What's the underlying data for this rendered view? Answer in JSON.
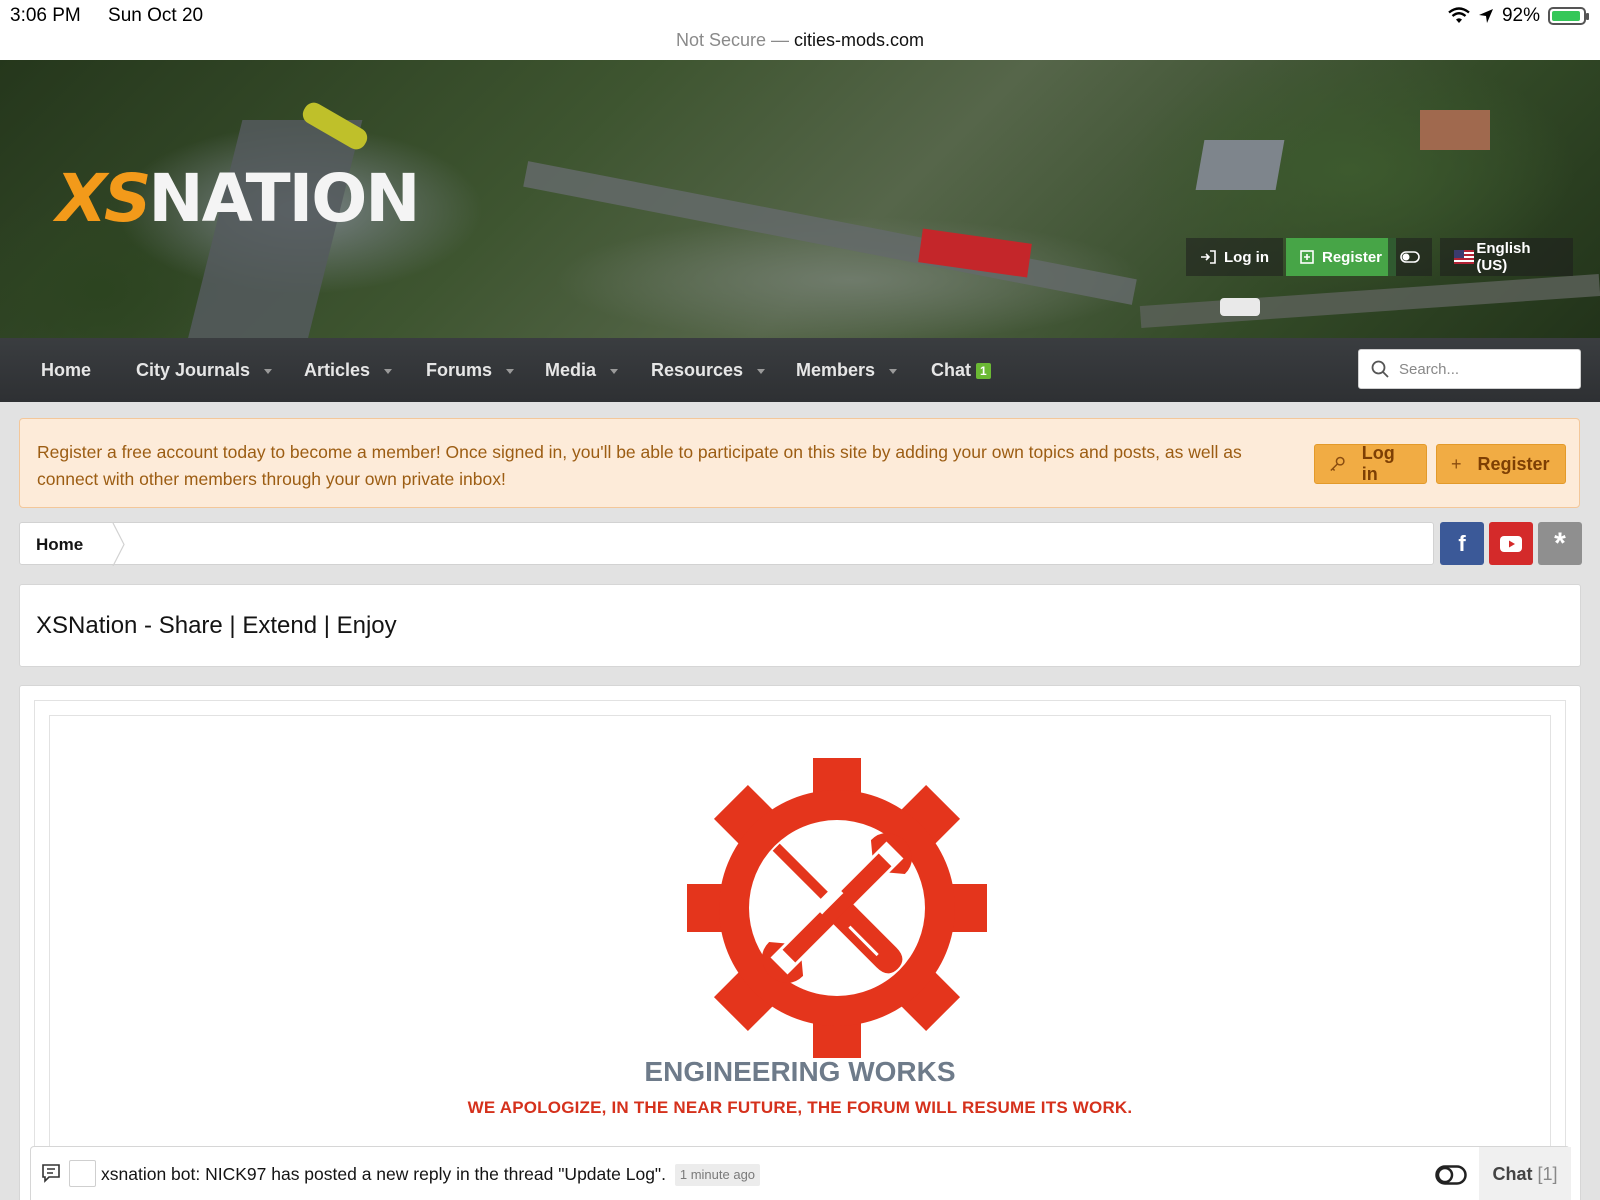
{
  "status_bar": {
    "time": "3:06 PM",
    "date": "Sun Oct 20",
    "battery": "92%",
    "battery_level": 0.92
  },
  "url_bar": {
    "security": "Not Secure —",
    "host": "cities-mods.com"
  },
  "header": {
    "logo_prefix": "XS",
    "logo_name": "NATION",
    "login_label": "Log in",
    "register_label": "Register",
    "language_label": "English (US)"
  },
  "nav": {
    "items": [
      {
        "label": "Home"
      },
      {
        "label": "City Journals"
      },
      {
        "label": "Articles"
      },
      {
        "label": "Forums"
      },
      {
        "label": "Media"
      },
      {
        "label": "Resources"
      },
      {
        "label": "Members"
      },
      {
        "label": "Chat"
      }
    ],
    "chat_badge": "1",
    "search_placeholder": "Search..."
  },
  "notice": {
    "text": "Register a free account today to become a member! Once signed in, you'll be able to participate on this site by adding your own topics and posts, as well as connect with other members through your own private inbox!",
    "login_label": "Log in",
    "register_label": "Register",
    "plus": "+"
  },
  "breadcrumb": {
    "home": "Home"
  },
  "social": {
    "facebook": "f",
    "star": "*"
  },
  "page": {
    "title": "XSNation - Share | Extend | Enjoy"
  },
  "maintenance": {
    "title": "ENGINEERING WORKS",
    "subtitle": "WE APOLOGIZE, IN THE NEAR FUTURE, THE FORUM WILL RESUME ITS WORK."
  },
  "chat_bar": {
    "message": "xsnation bot: NICK97 has posted a new reply in the thread \"Update Log\".",
    "time": "1 minute ago",
    "label": "Chat",
    "count": "[1]"
  },
  "colors": {
    "accent_green": "#47a547",
    "notice_bg": "#fdebd9",
    "notice_button": "#f1ac44",
    "maintenance_red": "#d5311c",
    "facebook": "#3b5998",
    "youtube": "#d42a2a"
  }
}
